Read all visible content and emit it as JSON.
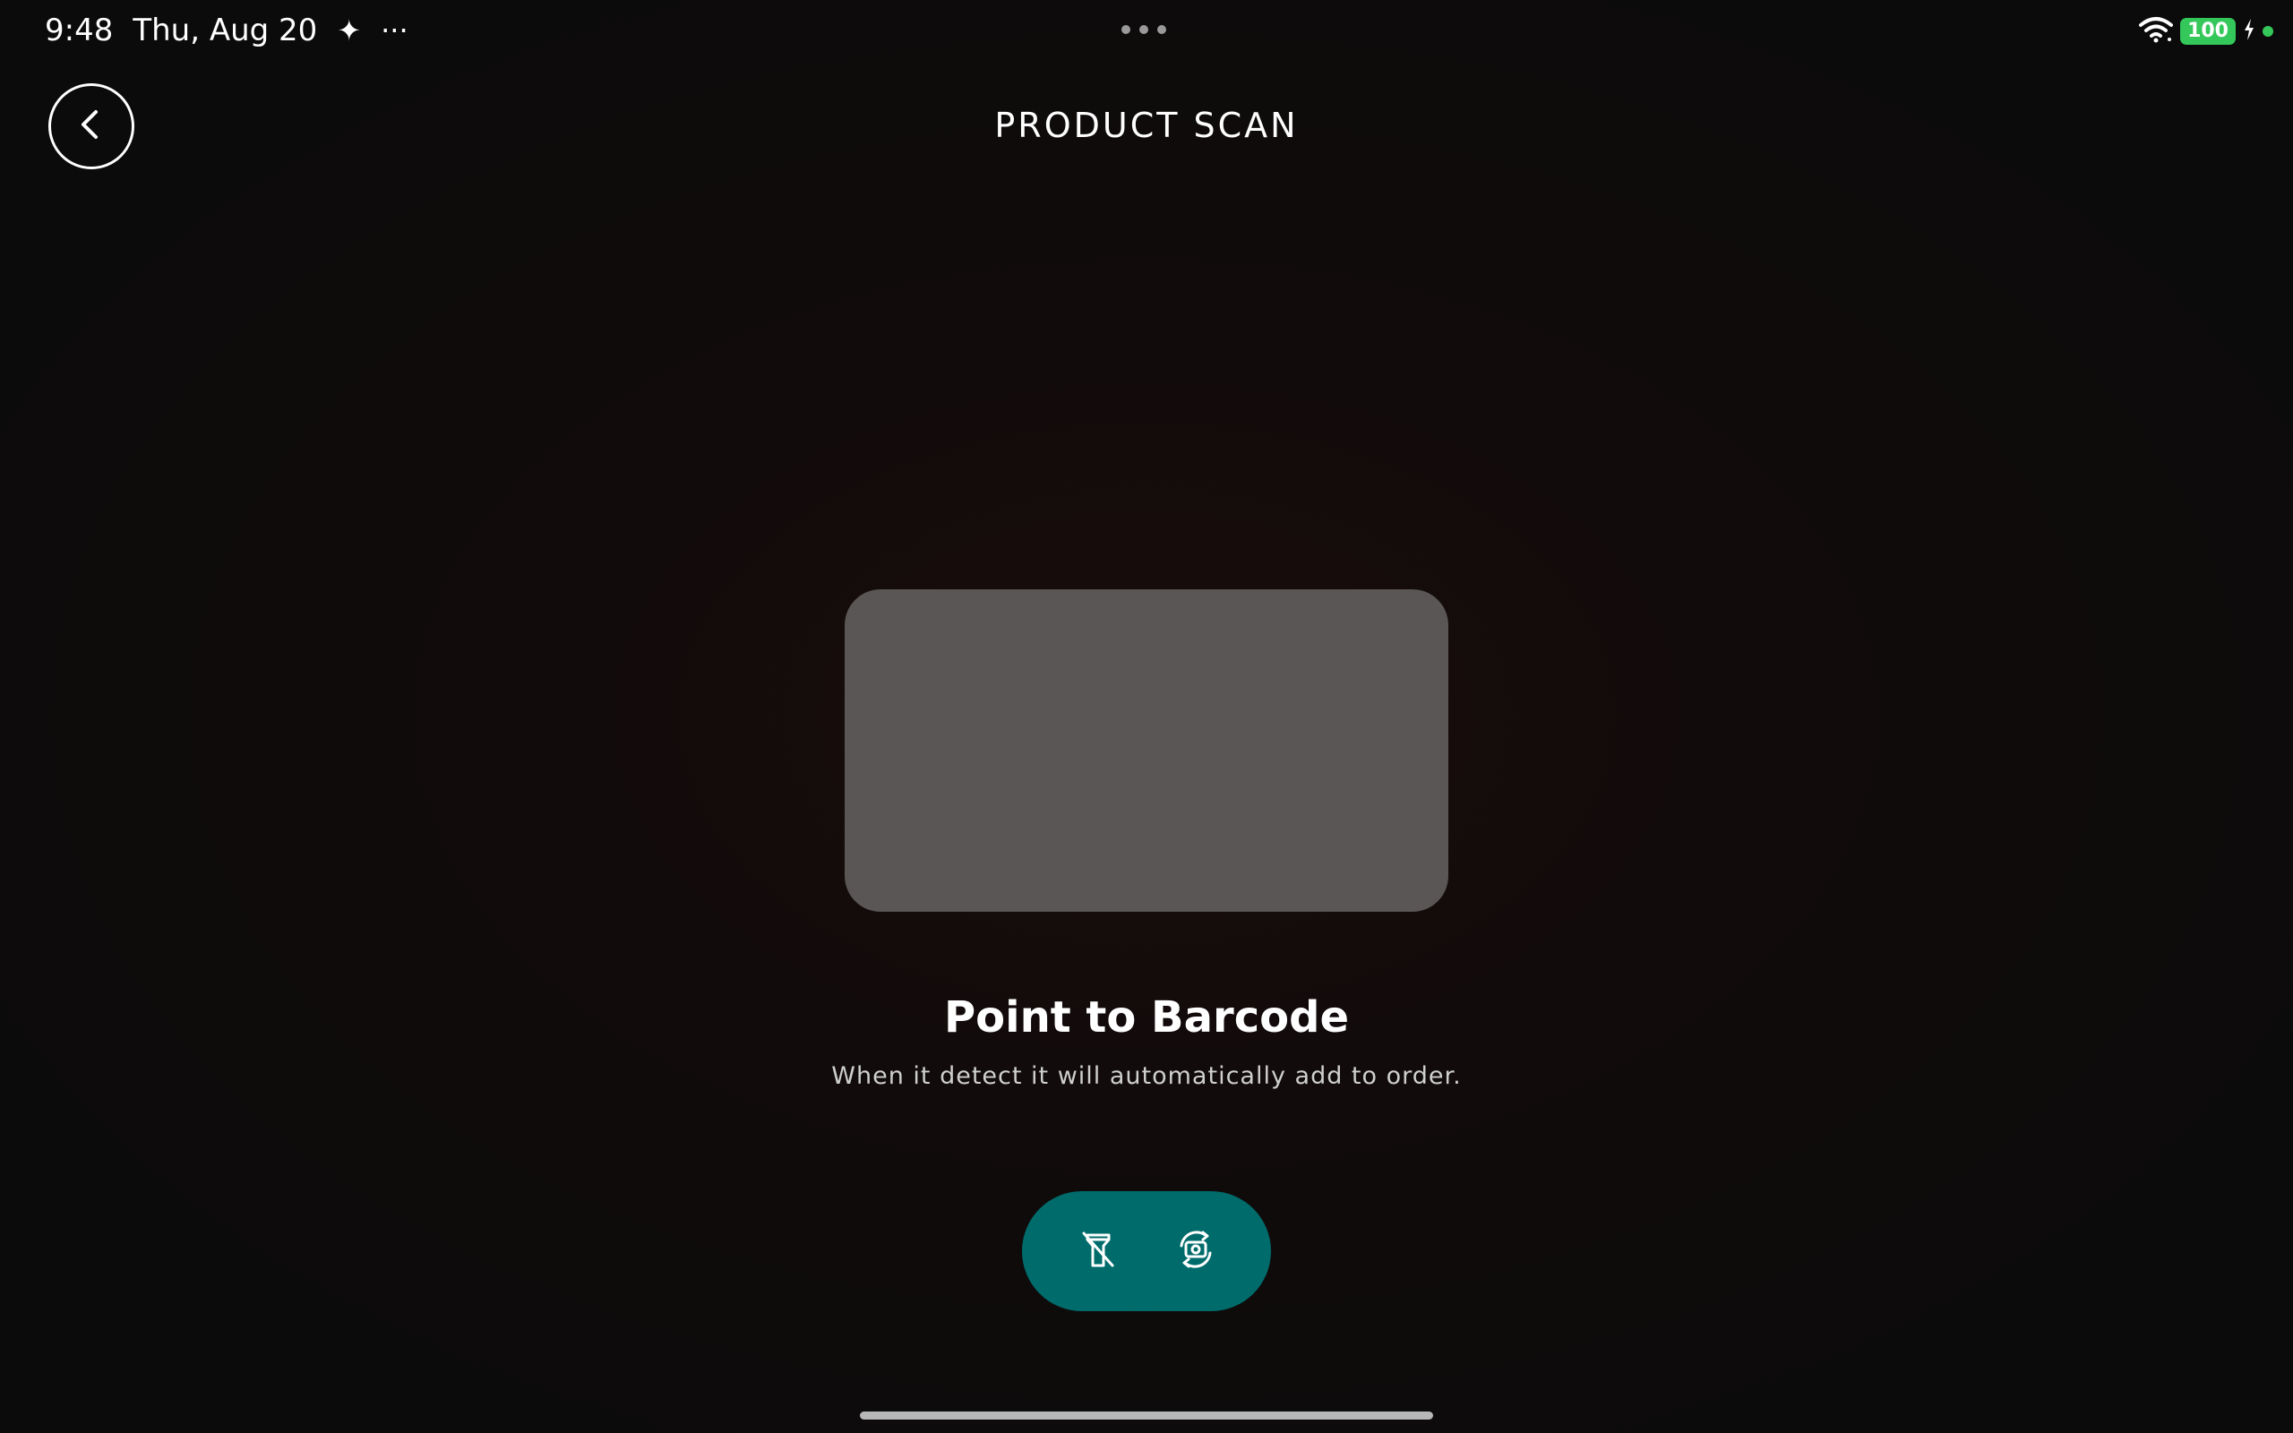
{
  "status_bar": {
    "time": "9:48",
    "date": "Thu, Aug 20",
    "sparkle": "✦",
    "more": "···",
    "battery_level": "100",
    "icons": [
      "wifi-icon",
      "battery-icon",
      "charging-icon"
    ]
  },
  "header": {
    "title": "PRODUCT SCAN",
    "back_icon": "chevron-left-icon"
  },
  "scan": {
    "title": "Point to Barcode",
    "subtitle": "When it detect it will automatically add to order."
  },
  "controls": {
    "flash_icon": "flashlight-off-icon",
    "switch_camera_icon": "camera-switch-icon",
    "accent_color": "#006b6b"
  },
  "colors": {
    "background": "#0d0b0b",
    "scan_frame": "#5a5656",
    "battery": "#34c759"
  }
}
